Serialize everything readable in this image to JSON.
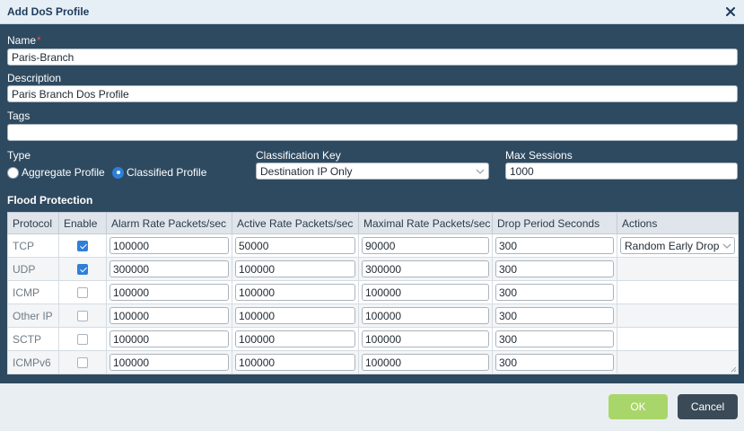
{
  "dialog": {
    "title": "Add DoS Profile"
  },
  "form": {
    "name_label": "Name",
    "required_mark": "*",
    "name_value": "Paris-Branch",
    "description_label": "Description",
    "description_value": "Paris Branch Dos Profile",
    "tags_label": "Tags",
    "tags_value": "",
    "type_label": "Type",
    "type_options": [
      "Aggregate Profile",
      "Classified Profile"
    ],
    "type_selected": "Classified Profile",
    "classification_key_label": "Classification Key",
    "classification_key_value": "Destination IP Only",
    "max_sessions_label": "Max Sessions",
    "max_sessions_value": "1000"
  },
  "flood_protection": {
    "title": "Flood Protection",
    "columns": [
      "Protocol",
      "Enable",
      "Alarm Rate Packets/sec",
      "Active Rate Packets/sec",
      "Maximal Rate Packets/sec",
      "Drop Period Seconds",
      "Actions"
    ],
    "rows": [
      {
        "protocol": "TCP",
        "enabled": true,
        "alarm": "100000",
        "active": "50000",
        "maximal": "90000",
        "drop": "300",
        "action": "Random Early Drop"
      },
      {
        "protocol": "UDP",
        "enabled": true,
        "alarm": "300000",
        "active": "100000",
        "maximal": "300000",
        "drop": "300",
        "action": ""
      },
      {
        "protocol": "ICMP",
        "enabled": false,
        "alarm": "100000",
        "active": "100000",
        "maximal": "100000",
        "drop": "300",
        "action": ""
      },
      {
        "protocol": "Other IP",
        "enabled": false,
        "alarm": "100000",
        "active": "100000",
        "maximal": "100000",
        "drop": "300",
        "action": ""
      },
      {
        "protocol": "SCTP",
        "enabled": false,
        "alarm": "100000",
        "active": "100000",
        "maximal": "100000",
        "drop": "300",
        "action": ""
      },
      {
        "protocol": "ICMPv6",
        "enabled": false,
        "alarm": "100000",
        "active": "100000",
        "maximal": "100000",
        "drop": "300",
        "action": ""
      }
    ]
  },
  "footer": {
    "ok_label": "OK",
    "cancel_label": "Cancel"
  },
  "colors": {
    "panel": "#2e4a60",
    "ok": "#a9d66a",
    "cancel": "#3a4a57",
    "accent": "#2f7fd8"
  }
}
